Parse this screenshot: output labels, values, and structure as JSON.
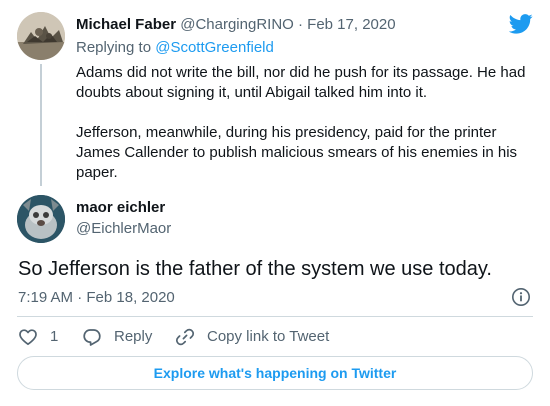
{
  "parent_tweet": {
    "name": "Michael Faber",
    "handle": "@ChargingRINO",
    "separator": "·",
    "date": "Feb 17, 2020",
    "replying_label": "Replying to",
    "replying_to": "@ScottGreenfield",
    "paragraphs": [
      "Adams did not write the bill, nor did he push for its passage.  He had doubts about signing it, until Abigail talked him into it.",
      "Jefferson, meanwhile, during his presidency, paid for the printer James Callender to publish malicious smears of his enemies in his paper."
    ]
  },
  "main_tweet": {
    "name": "maor eichler",
    "handle": "@EichlerMaor",
    "text": "So Jefferson is the father of the system we use today.",
    "timestamp": "7:19 AM · Feb 18, 2020"
  },
  "actions": {
    "like_count": "1",
    "reply_label": "Reply",
    "copy_label": "Copy link to Tweet"
  },
  "explore_label": "Explore what's happening on Twitter",
  "icons": {
    "brand": "twitter-bird-icon",
    "info": "info-icon",
    "like": "heart-icon",
    "reply": "reply-bubble-icon",
    "copy": "link-icon"
  },
  "colors": {
    "brand": "#1d9bf0",
    "text": "#0f1419",
    "muted": "#536471",
    "border": "#cfd9de"
  }
}
